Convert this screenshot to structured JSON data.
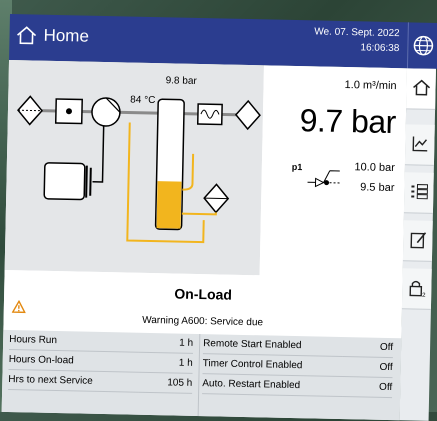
{
  "header": {
    "title": "Home",
    "date": "We. 07. Sept. 2022",
    "time": "16:06:38"
  },
  "diagram": {
    "tank_pressure": "9.8 bar",
    "temperature": "84 °C"
  },
  "readings": {
    "flow": "1.0 m³/min",
    "pressure": "9.7 bar",
    "p1_label": "p1",
    "setpoint_high": "10.0 bar",
    "setpoint_low": "9.5 bar"
  },
  "status": {
    "state": "On-Load",
    "warning": "Warning A600: Service due"
  },
  "table": {
    "left": [
      {
        "label": "Hours Run",
        "value": "1 h"
      },
      {
        "label": "Hours On-load",
        "value": "1 h"
      },
      {
        "label": "Hrs to next Service",
        "value": "105 h"
      }
    ],
    "right": [
      {
        "label": "Remote Start Enabled",
        "value": "Off"
      },
      {
        "label": "Timer Control Enabled",
        "value": "Off"
      },
      {
        "label": "Auto. Restart Enabled",
        "value": "Off"
      }
    ]
  },
  "sidebar": {
    "items": [
      {
        "icon": "home-icon"
      },
      {
        "icon": "chart-icon"
      },
      {
        "icon": "list-icon"
      },
      {
        "icon": "edit-icon"
      },
      {
        "icon": "lock-icon"
      }
    ]
  },
  "colors": {
    "header": "#2b3d8f",
    "oil": "#f2b51e",
    "diagram_bg": "#e4e6e8"
  }
}
